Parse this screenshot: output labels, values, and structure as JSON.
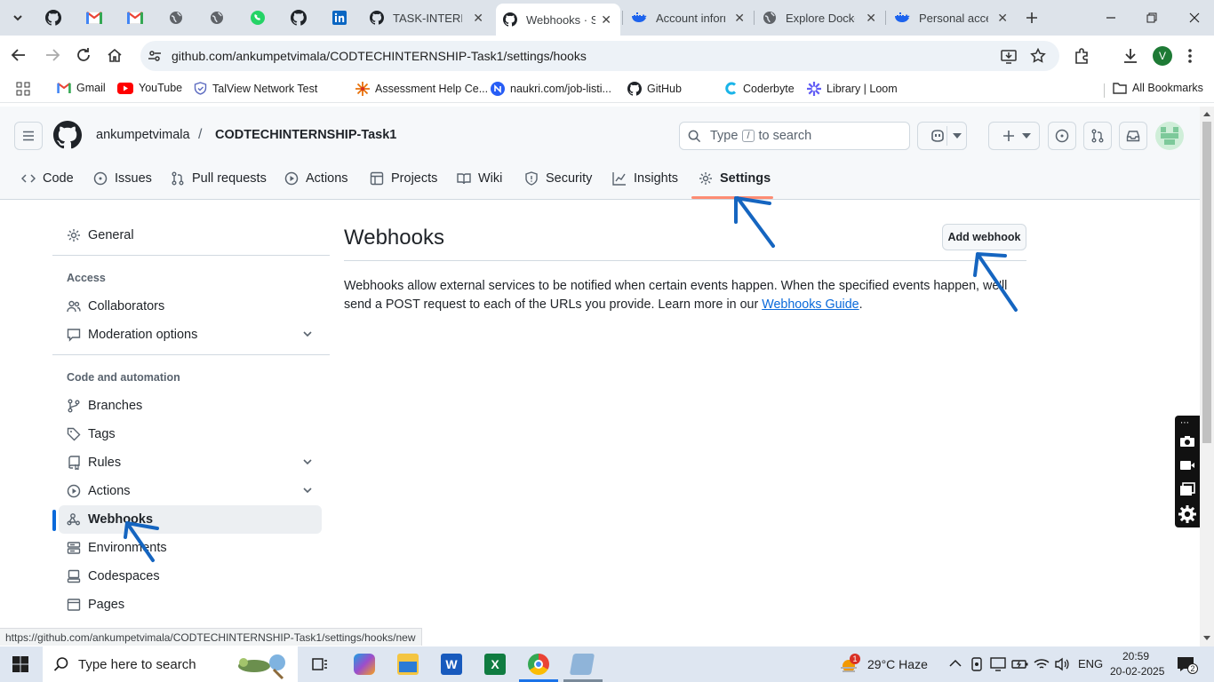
{
  "browser": {
    "tabs": [
      {
        "label": "TASK-INTERN",
        "icon": "github-icon"
      },
      {
        "label": "Webhooks · Se",
        "icon": "github-icon",
        "active": true
      },
      {
        "label": "Account inform",
        "icon": "docker-icon"
      },
      {
        "label": "Explore Docke",
        "icon": "globe-icon"
      },
      {
        "label": "Personal acces",
        "icon": "docker-icon"
      }
    ],
    "pinned_icons": [
      "github-icon",
      "gmail-icon",
      "gmail-icon",
      "globe-icon",
      "globe-icon",
      "whatsapp-icon",
      "github-icon",
      "linkedin-icon"
    ],
    "url": "github.com/ankumpetvimala/CODTECHINTERNSHIP-Task1/settings/hooks",
    "profile_initial": "V",
    "bookmarks": [
      "Gmail",
      "YouTube",
      "TalView Network Test",
      "Assessment Help Ce...",
      "naukri.com/job-listi...",
      "GitHub",
      "Coderbyte",
      "Library | Loom"
    ],
    "all_bookmarks": "All Bookmarks",
    "status_url": "https://github.com/ankumpetvimala/CODTECHINTERNSHIP-Task1/settings/hooks/new"
  },
  "github": {
    "owner": "ankumpetvimala",
    "slash": "/",
    "repo": "CODTECHINTERNSHIP-Task1",
    "search": {
      "before": "Type",
      "key": "/",
      "after": "to search"
    },
    "nav": [
      "Code",
      "Issues",
      "Pull requests",
      "Actions",
      "Projects",
      "Wiki",
      "Security",
      "Insights",
      "Settings"
    ],
    "sidebar": {
      "general": "General",
      "access_header": "Access",
      "access": [
        "Collaborators",
        "Moderation options"
      ],
      "code_header": "Code and automation",
      "code": [
        "Branches",
        "Tags",
        "Rules",
        "Actions",
        "Webhooks",
        "Environments",
        "Codespaces",
        "Pages"
      ]
    },
    "main": {
      "title": "Webhooks",
      "add_button": "Add webhook",
      "description": "Webhooks allow external services to be notified when certain events happen. When the specified events happen, we'll send a POST request to each of the URLs you provide. Learn more in our",
      "link": "Webhooks Guide",
      "period": "."
    }
  },
  "taskbar": {
    "search_placeholder": "Type here to search",
    "weather": "29°C  Haze",
    "weather_badge": "1",
    "lang": "ENG",
    "time": "20:59",
    "date": "20-02-2025",
    "notifications": "2"
  },
  "colors": {
    "annotation": "#1565c0",
    "accent": "#fd8c73",
    "link": "#0969da"
  }
}
